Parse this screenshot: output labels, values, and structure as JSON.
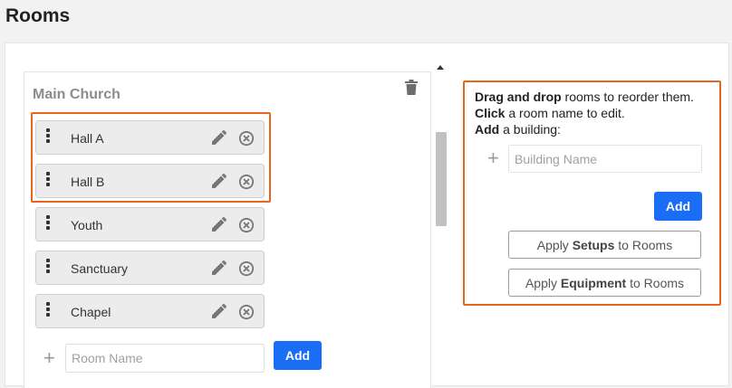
{
  "page": {
    "title": "Rooms"
  },
  "building": {
    "name": "Main Church",
    "rooms": [
      {
        "label": "Hall A"
      },
      {
        "label": "Hall B"
      },
      {
        "label": "Youth"
      },
      {
        "label": "Sanctuary"
      },
      {
        "label": "Chapel"
      }
    ],
    "room_input_placeholder": "Room Name",
    "add_room_label": "Add"
  },
  "help": {
    "line1_bold": "Drag and drop",
    "line1_rest": " rooms to reorder them. ",
    "line2_bold": "Click",
    "line2_rest": " a room name to edit.",
    "line3_bold": "Add",
    "line3_rest": " a building:",
    "building_input_placeholder": "Building Name",
    "add_building_label": "Add",
    "setups_pre": "Apply ",
    "setups_bold": "Setups",
    "setups_post": " to Rooms",
    "equipment_pre": "Apply ",
    "equipment_bold": "Equipment",
    "equipment_post": " to Rooms"
  },
  "colors": {
    "accent": "#1a6ef5",
    "highlight": "#e8661c"
  },
  "icons": {
    "trash": "trash-icon",
    "drag": "drag-handle-icon",
    "edit": "pencil-icon",
    "remove": "remove-circle-icon",
    "add": "plus-icon"
  }
}
